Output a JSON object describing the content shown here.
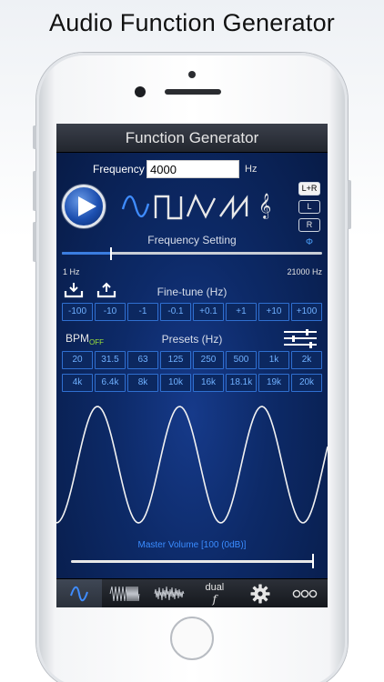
{
  "headline": "Audio Function Generator",
  "app": {
    "title": "Function Generator",
    "frequency": {
      "label": "Frequency",
      "value": "4000",
      "unit": "Hz"
    },
    "channels": [
      "L+R",
      "L",
      "R"
    ],
    "phase_symbol": "Φ",
    "frequency_setting": {
      "label": "Frequency Setting",
      "min_label": "1 Hz",
      "max_label": "21000 Hz",
      "position": 0.19
    },
    "finetune": {
      "label": "Fine-tune (Hz)",
      "buttons": [
        "-100",
        "-10",
        "-1",
        "-0.1",
        "+0.1",
        "+1",
        "+10",
        "+100"
      ]
    },
    "bpm": {
      "label": "BPM",
      "state": "OFF"
    },
    "presets": {
      "label": "Presets (Hz)",
      "row1": [
        "20",
        "31.5",
        "63",
        "125",
        "250",
        "500",
        "1k",
        "2k"
      ],
      "row2": [
        "4k",
        "6.4k",
        "8k",
        "10k",
        "16k",
        "18.1k",
        "19k",
        "20k"
      ]
    },
    "master_volume": {
      "label": "Master Volume [100 (0dB)]",
      "level": 1.0
    },
    "tabs": {
      "dual_line1": "dual",
      "dual_line2": "f"
    },
    "colors": {
      "accent": "#3b7de0",
      "preset_text": "#6fb0ff",
      "bpm_off": "#9be03a"
    }
  }
}
